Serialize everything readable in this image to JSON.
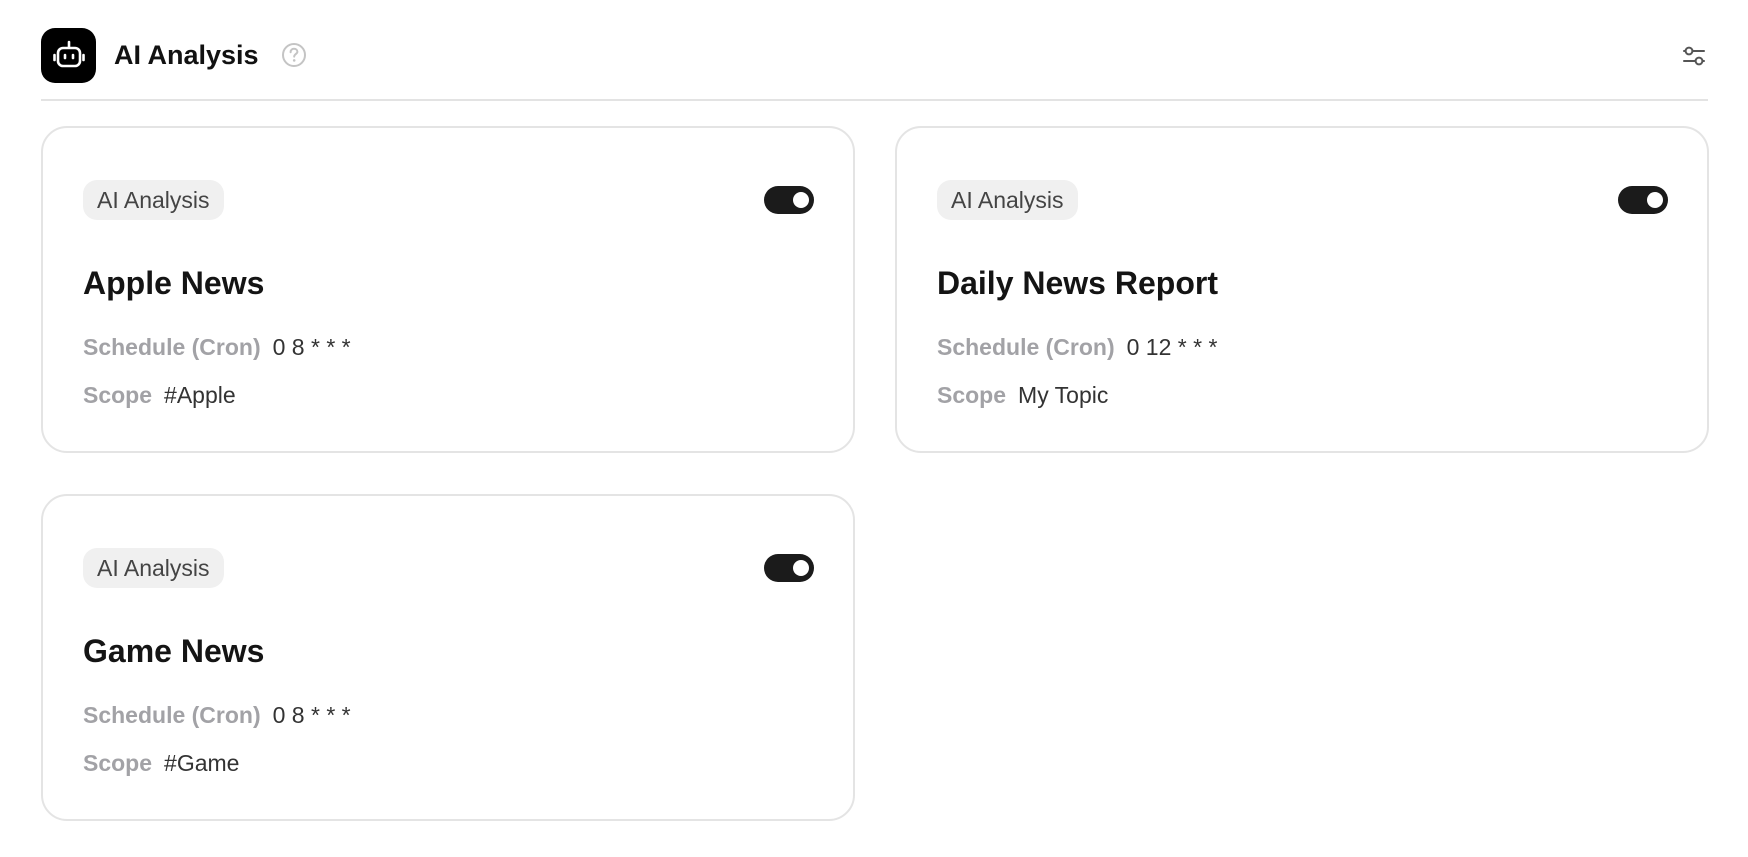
{
  "header": {
    "title": "AI Analysis",
    "logo_icon": "robot-icon",
    "help_icon": "help-circle-icon",
    "settings_icon": "sliders-icon"
  },
  "labels": {
    "schedule": "Schedule (Cron)",
    "scope": "Scope"
  },
  "cards": [
    {
      "tag": "AI Analysis",
      "title": "Apple News",
      "schedule": "0 8 * * *",
      "scope": "#Apple",
      "enabled": true
    },
    {
      "tag": "AI Analysis",
      "title": "Daily News Report",
      "schedule": "0 12 * * *",
      "scope": "My Topic",
      "enabled": true
    },
    {
      "tag": "AI Analysis",
      "title": "Game News",
      "schedule": "0 8 * * *",
      "scope": "#Game",
      "enabled": true
    }
  ],
  "colors": {
    "toggle_on": "#1b1b1b",
    "tag_bg": "#f0f0f0",
    "label": "#a2a2a6"
  }
}
